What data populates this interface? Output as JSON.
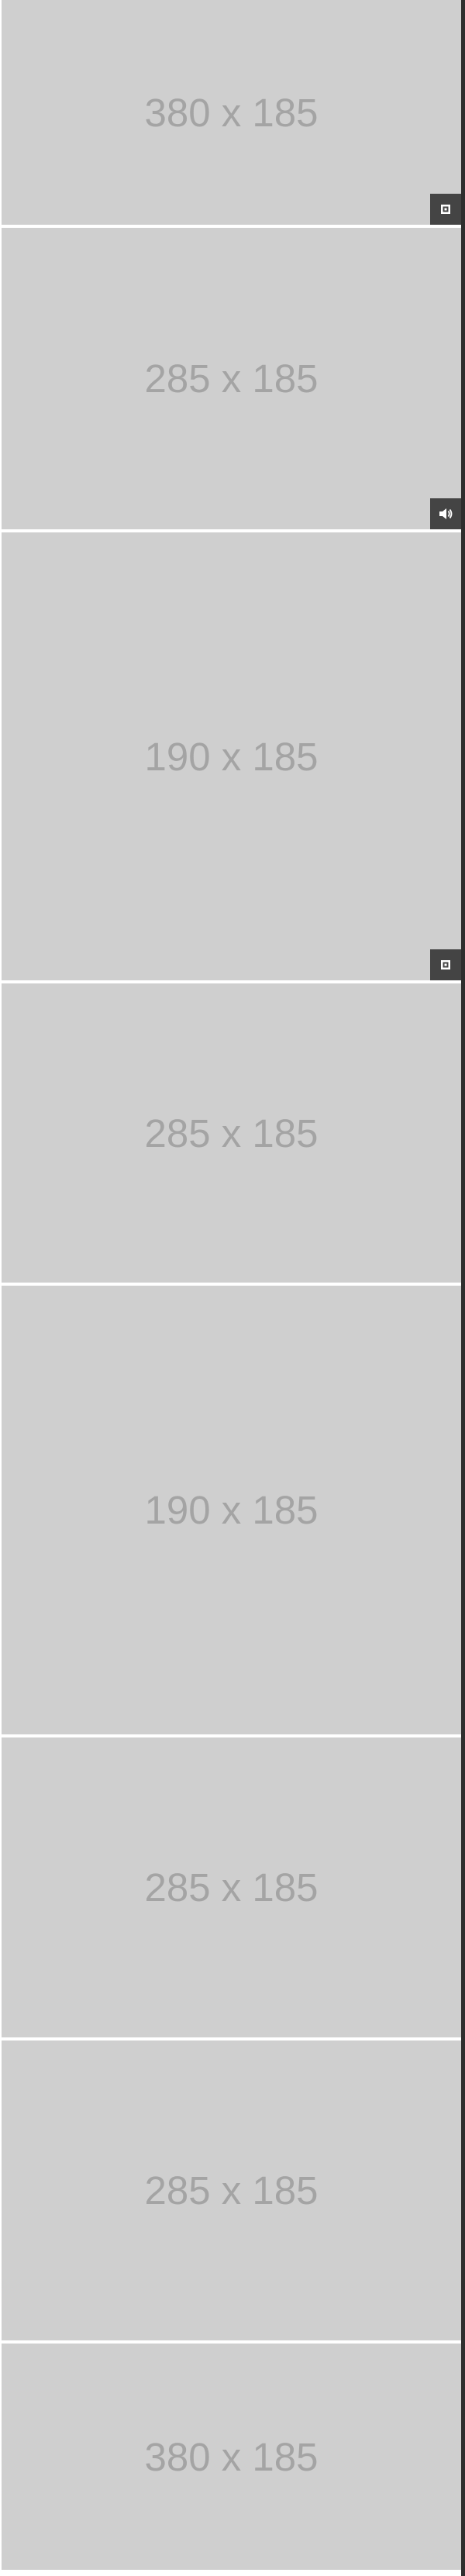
{
  "tiles": [
    {
      "label": "380 x 185",
      "badge": "image-icon"
    },
    {
      "label": "285 x 185",
      "badge": "audio-icon"
    },
    {
      "label": "190 x 185",
      "badge": "image-icon"
    },
    {
      "label": "285 x 185",
      "badge": null
    },
    {
      "label": "190 x 185",
      "badge": null
    },
    {
      "label": "285 x 185",
      "badge": null
    },
    {
      "label": "285 x 185",
      "badge": null
    },
    {
      "label": "380 x 185",
      "badge": null
    }
  ],
  "colors": {
    "tile_background": "#cfcfcf",
    "tile_label": "#a4a4a4",
    "badge_background": "#444444",
    "badge_glyph": "#ffffff",
    "gap": "#ffffff"
  }
}
